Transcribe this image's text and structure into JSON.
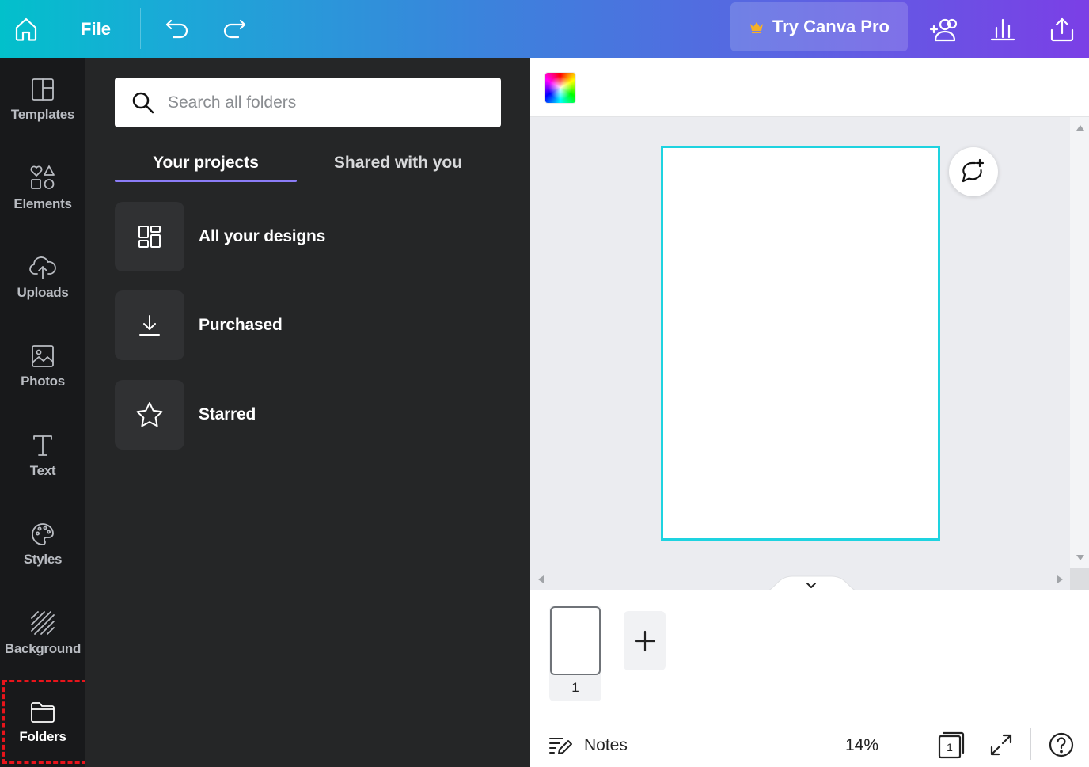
{
  "topbar": {
    "file_label": "File",
    "pro_label": "Try Canva Pro",
    "icons": [
      "home-icon",
      "undo-icon",
      "redo-icon",
      "crown-icon",
      "add-people-icon",
      "insights-icon",
      "share-icon"
    ]
  },
  "sidebar": {
    "items": [
      {
        "label": "Templates",
        "icon": "templates-icon"
      },
      {
        "label": "Elements",
        "icon": "elements-icon"
      },
      {
        "label": "Uploads",
        "icon": "upload-cloud-icon"
      },
      {
        "label": "Photos",
        "icon": "image-icon"
      },
      {
        "label": "Text",
        "icon": "text-icon"
      },
      {
        "label": "Styles",
        "icon": "palette-icon"
      },
      {
        "label": "Background",
        "icon": "background-pattern-icon"
      },
      {
        "label": "Folders",
        "icon": "folder-icon"
      }
    ],
    "active": "Folders"
  },
  "panel": {
    "search_placeholder": "Search all folders",
    "tabs": [
      {
        "label": "Your projects",
        "active": true
      },
      {
        "label": "Shared with you",
        "active": false
      }
    ],
    "folders": [
      {
        "label": "All your designs",
        "icon": "grid-layout-icon"
      },
      {
        "label": "Purchased",
        "icon": "download-icon"
      },
      {
        "label": "Starred",
        "icon": "star-icon"
      }
    ]
  },
  "editor": {
    "page_number": "1",
    "zoom": "14%",
    "notes_label": "Notes",
    "page_count_icon_value": "1"
  },
  "colors": {
    "accent_underline": "#8b7cf6",
    "canvas_border": "#1ed3e0",
    "highlight": "#e8141b",
    "panel_bg": "#252627",
    "rail_bg": "#18191b"
  }
}
